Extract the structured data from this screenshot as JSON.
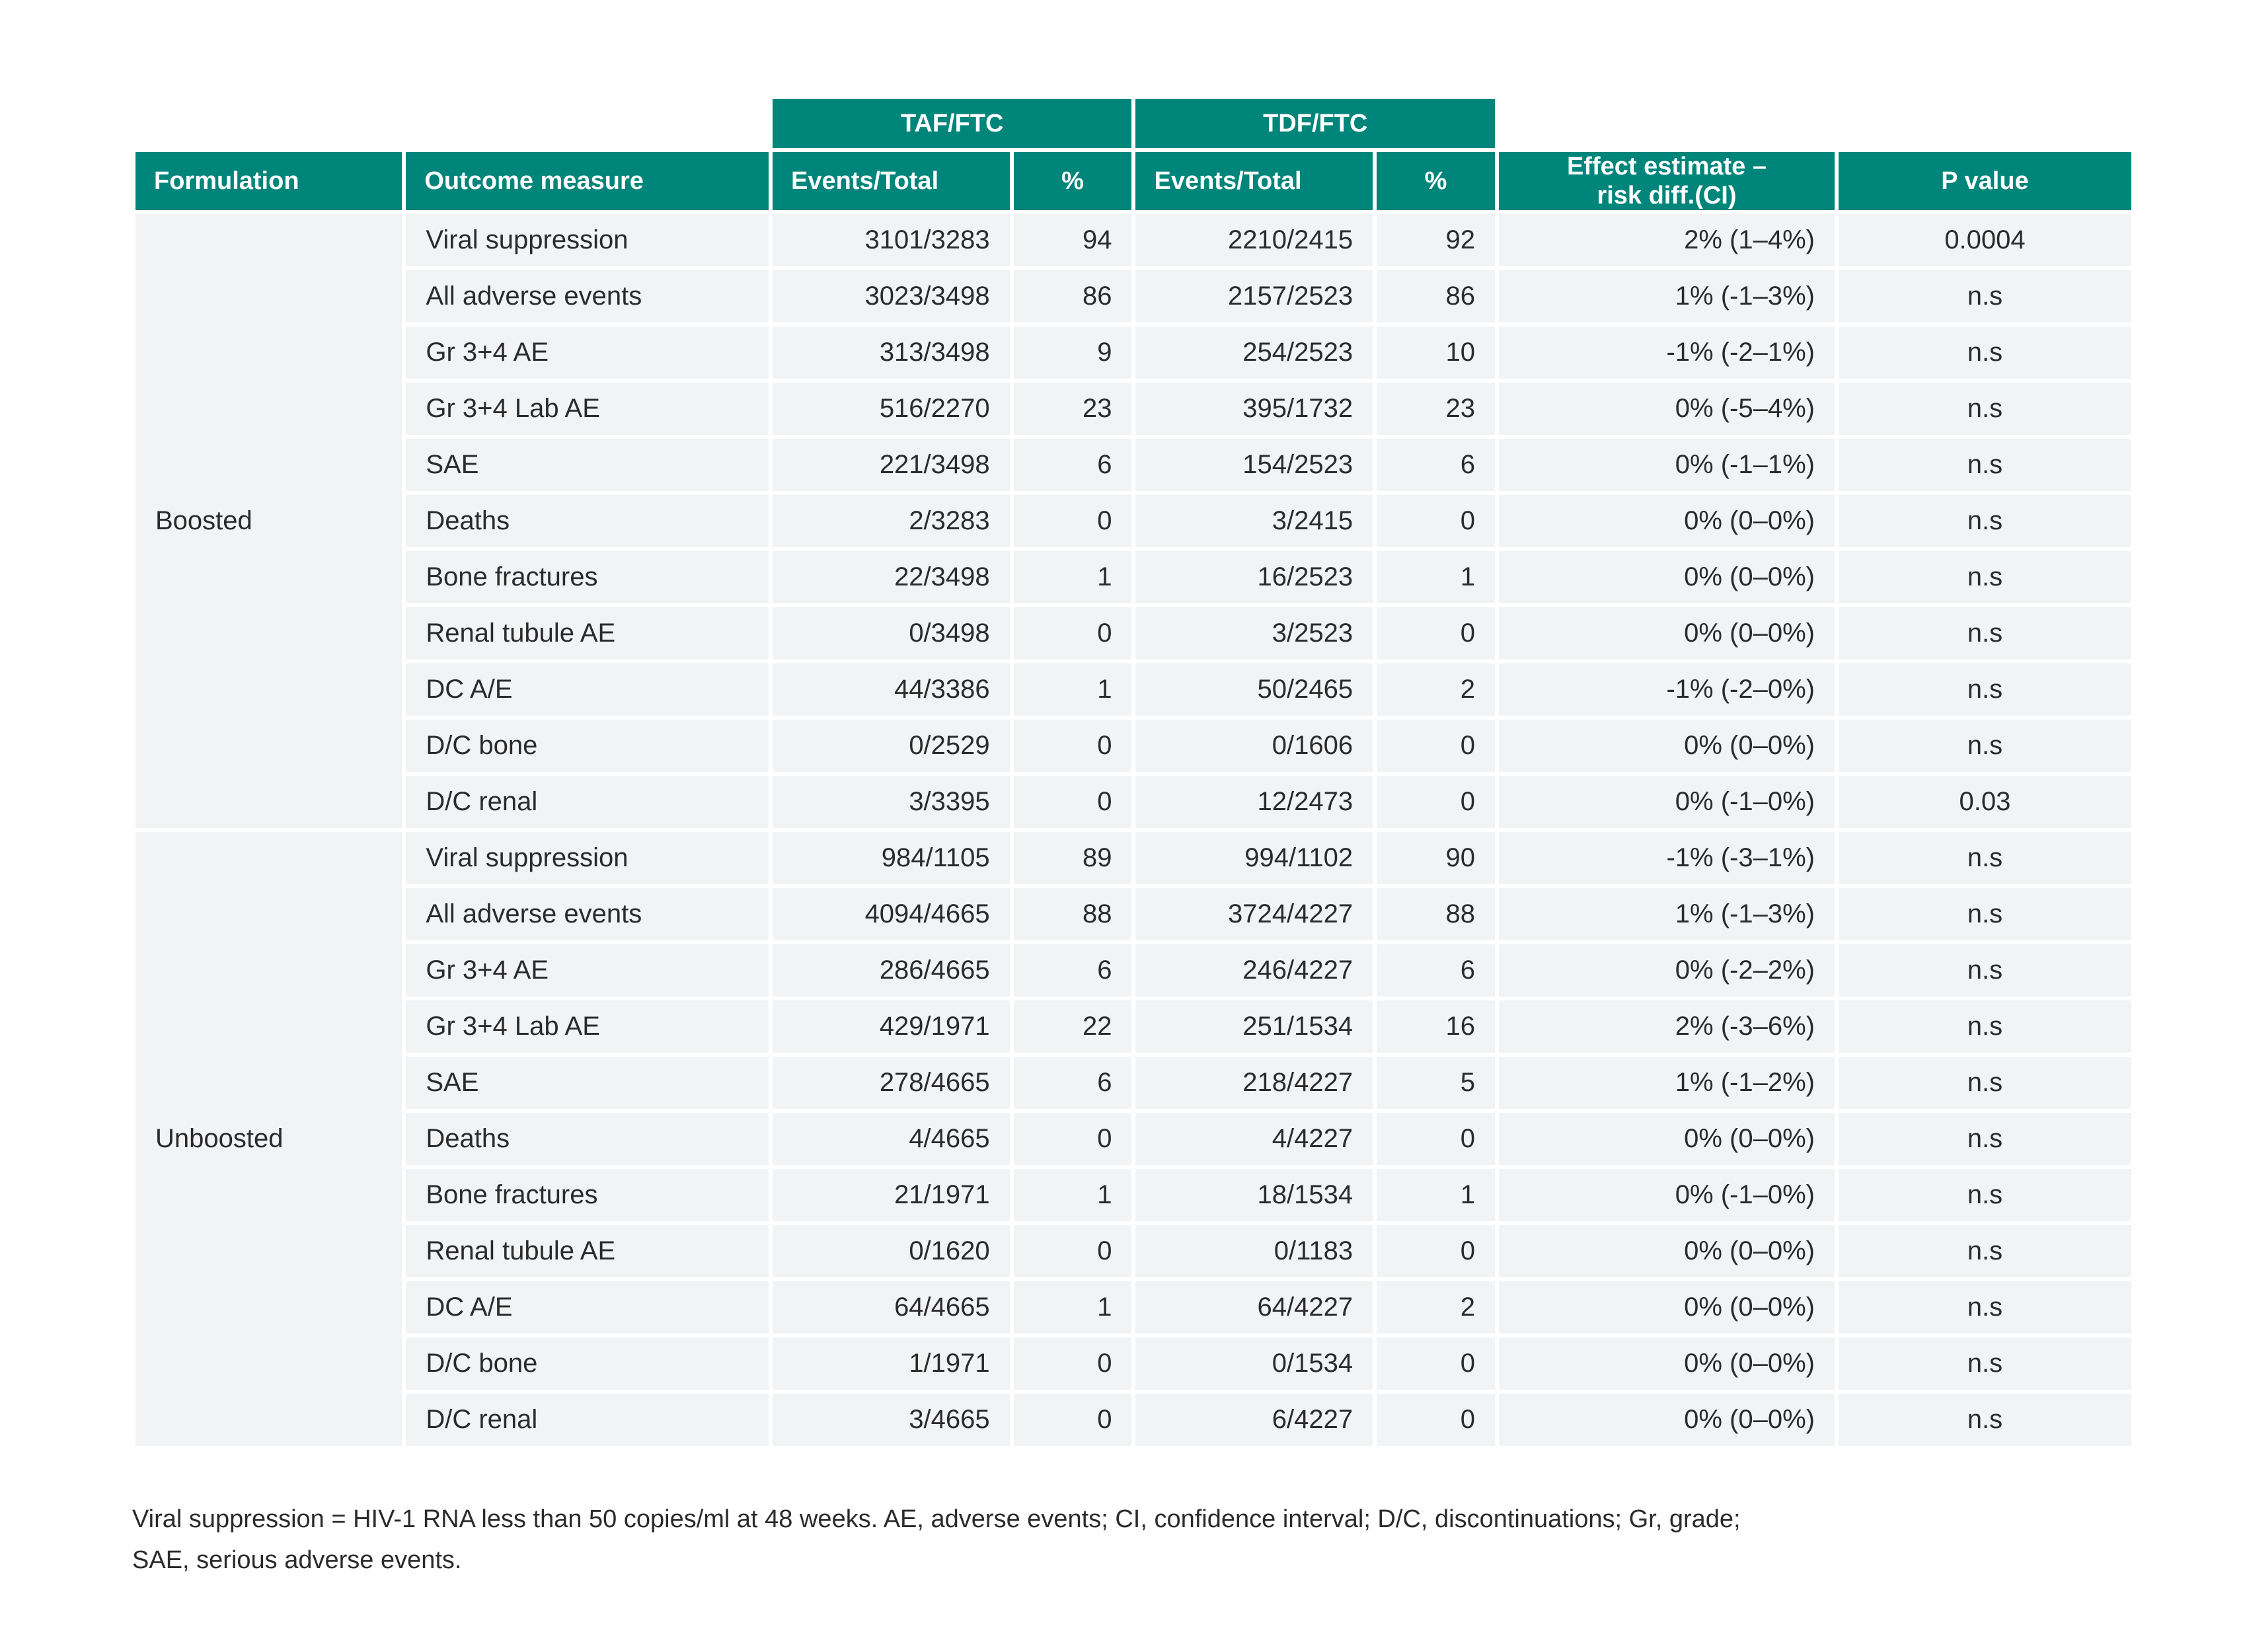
{
  "header": {
    "group_taf": "TAF/FTC",
    "group_tdf": "TDF/FTC",
    "formulation": "Formulation",
    "outcome": "Outcome measure",
    "taf_events": "Events/Total",
    "taf_pct": "%",
    "tdf_events": "Events/Total",
    "tdf_pct": "%",
    "effect_line1": "Effect estimate –",
    "effect_line2": "risk diff.(CI)",
    "pvalue": "P value"
  },
  "groups": [
    {
      "label": "Boosted",
      "rows": [
        {
          "outcome": "Viral suppression",
          "taf_events": "3101/3283",
          "taf_pct": "94",
          "tdf_events": "2210/2415",
          "tdf_pct": "92",
          "effect": "2% (1–4%)",
          "p": "0.0004"
        },
        {
          "outcome": "All adverse events",
          "taf_events": "3023/3498",
          "taf_pct": "86",
          "tdf_events": "2157/2523",
          "tdf_pct": "86",
          "effect": "1% (-1–3%)",
          "p": "n.s"
        },
        {
          "outcome": "Gr 3+4 AE",
          "taf_events": "313/3498",
          "taf_pct": "9",
          "tdf_events": "254/2523",
          "tdf_pct": "10",
          "effect": "-1% (-2–1%)",
          "p": "n.s"
        },
        {
          "outcome": "Gr 3+4 Lab AE",
          "taf_events": "516/2270",
          "taf_pct": "23",
          "tdf_events": "395/1732",
          "tdf_pct": "23",
          "effect": "0% (-5–4%)",
          "p": "n.s"
        },
        {
          "outcome": "SAE",
          "taf_events": "221/3498",
          "taf_pct": "6",
          "tdf_events": "154/2523",
          "tdf_pct": "6",
          "effect": "0% (-1–1%)",
          "p": "n.s"
        },
        {
          "outcome": "Deaths",
          "taf_events": "2/3283",
          "taf_pct": "0",
          "tdf_events": "3/2415",
          "tdf_pct": "0",
          "effect": "0% (0–0%)",
          "p": "n.s"
        },
        {
          "outcome": "Bone fractures",
          "taf_events": "22/3498",
          "taf_pct": "1",
          "tdf_events": "16/2523",
          "tdf_pct": "1",
          "effect": "0% (0–0%)",
          "p": "n.s"
        },
        {
          "outcome": "Renal tubule AE",
          "taf_events": "0/3498",
          "taf_pct": "0",
          "tdf_events": "3/2523",
          "tdf_pct": "0",
          "effect": "0% (0–0%)",
          "p": "n.s"
        },
        {
          "outcome": "DC A/E",
          "taf_events": "44/3386",
          "taf_pct": "1",
          "tdf_events": "50/2465",
          "tdf_pct": "2",
          "effect": "-1% (-2–0%)",
          "p": "n.s"
        },
        {
          "outcome": "D/C bone",
          "taf_events": "0/2529",
          "taf_pct": "0",
          "tdf_events": "0/1606",
          "tdf_pct": "0",
          "effect": "0% (0–0%)",
          "p": "n.s"
        },
        {
          "outcome": "D/C renal",
          "taf_events": "3/3395",
          "taf_pct": "0",
          "tdf_events": "12/2473",
          "tdf_pct": "0",
          "effect": "0% (-1–0%)",
          "p": "0.03"
        }
      ]
    },
    {
      "label": "Unboosted",
      "rows": [
        {
          "outcome": "Viral suppression",
          "taf_events": "984/1105",
          "taf_pct": "89",
          "tdf_events": "994/1102",
          "tdf_pct": "90",
          "effect": "-1% (-3–1%)",
          "p": "n.s"
        },
        {
          "outcome": "All adverse events",
          "taf_events": "4094/4665",
          "taf_pct": "88",
          "tdf_events": "3724/4227",
          "tdf_pct": "88",
          "effect": "1% (-1–3%)",
          "p": "n.s"
        },
        {
          "outcome": "Gr 3+4 AE",
          "taf_events": "286/4665",
          "taf_pct": "6",
          "tdf_events": "246/4227",
          "tdf_pct": "6",
          "effect": "0% (-2–2%)",
          "p": "n.s"
        },
        {
          "outcome": "Gr 3+4 Lab AE",
          "taf_events": "429/1971",
          "taf_pct": "22",
          "tdf_events": "251/1534",
          "tdf_pct": "16",
          "effect": "2% (-3–6%)",
          "p": "n.s"
        },
        {
          "outcome": "SAE",
          "taf_events": "278/4665",
          "taf_pct": "6",
          "tdf_events": "218/4227",
          "tdf_pct": "5",
          "effect": "1% (-1–2%)",
          "p": "n.s"
        },
        {
          "outcome": "Deaths",
          "taf_events": "4/4665",
          "taf_pct": "0",
          "tdf_events": "4/4227",
          "tdf_pct": "0",
          "effect": "0% (0–0%)",
          "p": "n.s"
        },
        {
          "outcome": "Bone fractures",
          "taf_events": "21/1971",
          "taf_pct": "1",
          "tdf_events": "18/1534",
          "tdf_pct": "1",
          "effect": "0% (-1–0%)",
          "p": "n.s"
        },
        {
          "outcome": "Renal tubule AE",
          "taf_events": "0/1620",
          "taf_pct": "0",
          "tdf_events": "0/1183",
          "tdf_pct": "0",
          "effect": "0% (0–0%)",
          "p": "n.s"
        },
        {
          "outcome": "DC A/E",
          "taf_events": "64/4665",
          "taf_pct": "1",
          "tdf_events": "64/4227",
          "tdf_pct": "2",
          "effect": "0% (0–0%)",
          "p": "n.s"
        },
        {
          "outcome": "D/C bone",
          "taf_events": "1/1971",
          "taf_pct": "0",
          "tdf_events": "0/1534",
          "tdf_pct": "0",
          "effect": "0% (0–0%)",
          "p": "n.s"
        },
        {
          "outcome": "D/C renal",
          "taf_events": "3/4665",
          "taf_pct": "0",
          "tdf_events": "6/4227",
          "tdf_pct": "0",
          "effect": "0% (0–0%)",
          "p": "n.s"
        }
      ]
    }
  ],
  "footnote": {
    "line1": "Viral suppression = HIV-1 RNA less than 50 copies/ml at 48 weeks. AE, adverse events; CI, confidence interval; D/C, discontinuations; Gr, grade;",
    "line2": "SAE, serious adverse events."
  }
}
